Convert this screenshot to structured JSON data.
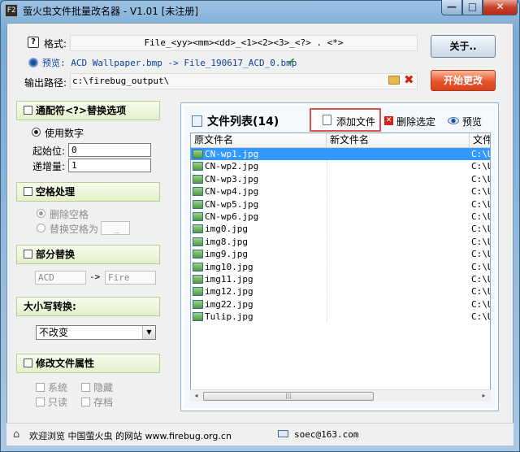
{
  "window": {
    "app_icon": "F2",
    "title": "萤火虫文件批量改名器 - V1.01 [未注册]",
    "controls": {
      "minimize": "—",
      "maximize": "□",
      "close": "✕"
    }
  },
  "top": {
    "format_label": "格式:",
    "format_value": "File_<yy><mm><dd>_<1><2><3>_<?> . <*>",
    "preview_label": "预览:",
    "preview_value": "ACD Wallpaper.bmp -> File_190617_ACD_0.bmp",
    "output_label": "输出路径:",
    "output_value": "c:\\firebug_output\\",
    "about_button": "关于..",
    "start_button": "开始更改"
  },
  "wildcard": {
    "title": "通配符<?>替换选项",
    "use_numbers": "使用数字",
    "start_label": "起始位:",
    "start_value": "0",
    "step_label": "递增量:",
    "step_value": "1"
  },
  "spaces": {
    "title": "空格处理",
    "remove": "删除空格",
    "replace": "替换空格为",
    "replace_value": "_"
  },
  "partial": {
    "title": "部分替换",
    "from_value": "ACD",
    "arrow": "->",
    "to_value": "Fire"
  },
  "case": {
    "title": "大小写转换:",
    "selected": "不改变"
  },
  "attrs": {
    "title": "修改文件属性",
    "system": "系统",
    "hidden": "隐藏",
    "readonly": "只读",
    "archive": "存档"
  },
  "file_list": {
    "title": "文件列表(14)",
    "add_file": "添加文件",
    "delete_selected": "删除选定",
    "preview": "预览",
    "columns": [
      "原文件名",
      "新文件名",
      "文件"
    ],
    "rows": [
      {
        "orig": "CN-wp1.jpg",
        "new": "",
        "path": "C:\\U"
      },
      {
        "orig": "CN-wp2.jpg",
        "new": "",
        "path": "C:\\U"
      },
      {
        "orig": "CN-wp3.jpg",
        "new": "",
        "path": "C:\\U"
      },
      {
        "orig": "CN-wp4.jpg",
        "new": "",
        "path": "C:\\U"
      },
      {
        "orig": "CN-wp5.jpg",
        "new": "",
        "path": "C:\\U"
      },
      {
        "orig": "CN-wp6.jpg",
        "new": "",
        "path": "C:\\U"
      },
      {
        "orig": "img0.jpg",
        "new": "",
        "path": "C:\\U"
      },
      {
        "orig": "img8.jpg",
        "new": "",
        "path": "C:\\U"
      },
      {
        "orig": "img9.jpg",
        "new": "",
        "path": "C:\\U"
      },
      {
        "orig": "img10.jpg",
        "new": "",
        "path": "C:\\U"
      },
      {
        "orig": "img11.jpg",
        "new": "",
        "path": "C:\\U"
      },
      {
        "orig": "img12.jpg",
        "new": "",
        "path": "C:\\U"
      },
      {
        "orig": "img22.jpg",
        "new": "",
        "path": "C:\\U"
      },
      {
        "orig": "Tulip.jpg",
        "new": "",
        "path": "C:\\U"
      }
    ],
    "scroll": {
      "left": "◂",
      "right": "▸",
      "grip": "|||"
    }
  },
  "status": {
    "welcome": "欢迎浏览 中国萤火虫 的网站 www.firebug.org.cn",
    "email": "soec@163.com"
  },
  "icons": {
    "help": "?",
    "check": "✔",
    "clear": "✖",
    "home": "⌂",
    "delete": "✕",
    "select_arrow": "▼"
  },
  "colors": {
    "selection": "#3399ff",
    "start_button": "#e7542a",
    "section_border": "#b7d090",
    "highlight_box": "#d9534f"
  }
}
